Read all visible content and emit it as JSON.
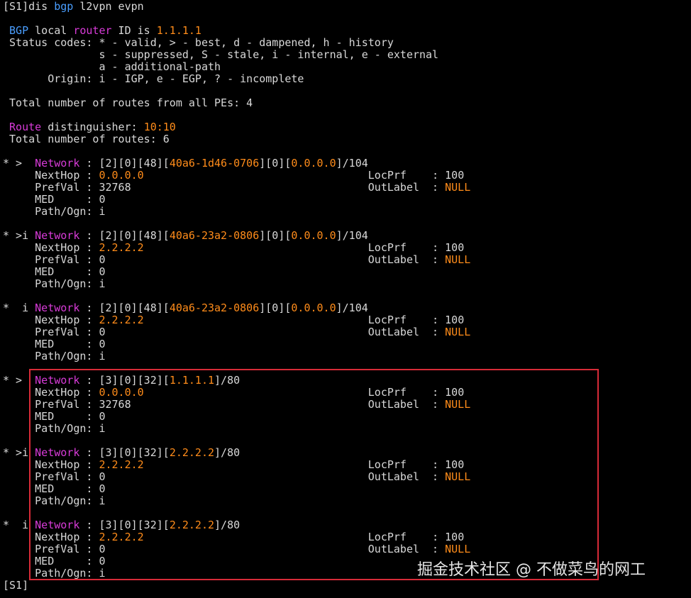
{
  "colors": {
    "background": "#000000",
    "text": "#d8d8d8",
    "keyword": "#4a9eff",
    "field": "#d83bd8",
    "value": "#ff8c1a",
    "highlight": "#d72b38"
  },
  "lines": [
    [
      [
        "t",
        "[S1]dis "
      ],
      [
        "b",
        "bgp"
      ],
      [
        "t",
        " l2vpn evpn"
      ]
    ],
    [
      [
        "t",
        ""
      ]
    ],
    [
      [
        "t",
        " "
      ],
      [
        "b",
        "BGP"
      ],
      [
        "t",
        " local "
      ],
      [
        "m",
        "router"
      ],
      [
        "t",
        " ID is "
      ],
      [
        "o",
        "1.1.1.1"
      ]
    ],
    [
      [
        "t",
        " Status codes: * - valid, > - best, d - dampened, h - history"
      ]
    ],
    [
      [
        "t",
        "               s - suppressed, S - stale, i - internal, e - external"
      ]
    ],
    [
      [
        "t",
        "               a - additional-path"
      ]
    ],
    [
      [
        "t",
        "       Origin: i - IGP, e - EGP, ? - incomplete"
      ]
    ],
    [
      [
        "t",
        ""
      ]
    ],
    [
      [
        "t",
        " Total number of routes from all PEs: 4"
      ]
    ],
    [
      [
        "t",
        ""
      ]
    ],
    [
      [
        "t",
        " "
      ],
      [
        "m",
        "Route"
      ],
      [
        "t",
        " distinguisher: "
      ],
      [
        "o",
        "10:10"
      ]
    ],
    [
      [
        "t",
        " Total number of routes: 6"
      ]
    ],
    [
      [
        "t",
        ""
      ]
    ],
    [
      [
        "t",
        "* >  "
      ],
      [
        "m",
        "Network"
      ],
      [
        "t",
        " : [2][0][48]["
      ],
      [
        "o",
        "40a6-1d46-0706"
      ],
      [
        "t",
        "][0]["
      ],
      [
        "o",
        "0.0.0.0"
      ],
      [
        "t",
        "]/104"
      ]
    ],
    [
      [
        "t",
        "     NextHop : "
      ],
      [
        "o",
        "0.0.0.0"
      ],
      [
        "t",
        "                                   LocPrf    : 100"
      ]
    ],
    [
      [
        "t",
        "     PrefVal : 32768                                     OutLabel  : "
      ],
      [
        "o",
        "NULL"
      ]
    ],
    [
      [
        "t",
        "     MED     : 0"
      ]
    ],
    [
      [
        "t",
        "     Path/Ogn: i"
      ]
    ],
    [
      [
        "t",
        ""
      ]
    ],
    [
      [
        "t",
        "* >i "
      ],
      [
        "m",
        "Network"
      ],
      [
        "t",
        " : [2][0][48]["
      ],
      [
        "o",
        "40a6-23a2-0806"
      ],
      [
        "t",
        "][0]["
      ],
      [
        "o",
        "0.0.0.0"
      ],
      [
        "t",
        "]/104"
      ]
    ],
    [
      [
        "t",
        "     NextHop : "
      ],
      [
        "o",
        "2.2.2.2"
      ],
      [
        "t",
        "                                   LocPrf    : 100"
      ]
    ],
    [
      [
        "t",
        "     PrefVal : 0                                         OutLabel  : "
      ],
      [
        "o",
        "NULL"
      ]
    ],
    [
      [
        "t",
        "     MED     : 0"
      ]
    ],
    [
      [
        "t",
        "     Path/Ogn: i"
      ]
    ],
    [
      [
        "t",
        ""
      ]
    ],
    [
      [
        "t",
        "*  i "
      ],
      [
        "m",
        "Network"
      ],
      [
        "t",
        " : [2][0][48]["
      ],
      [
        "o",
        "40a6-23a2-0806"
      ],
      [
        "t",
        "][0]["
      ],
      [
        "o",
        "0.0.0.0"
      ],
      [
        "t",
        "]/104"
      ]
    ],
    [
      [
        "t",
        "     NextHop : "
      ],
      [
        "o",
        "2.2.2.2"
      ],
      [
        "t",
        "                                   LocPrf    : 100"
      ]
    ],
    [
      [
        "t",
        "     PrefVal : 0                                         OutLabel  : "
      ],
      [
        "o",
        "NULL"
      ]
    ],
    [
      [
        "t",
        "     MED     : 0"
      ]
    ],
    [
      [
        "t",
        "     Path/Ogn: i"
      ]
    ],
    [
      [
        "t",
        ""
      ]
    ],
    [
      [
        "t",
        "* >  "
      ],
      [
        "m",
        "Network"
      ],
      [
        "t",
        " : [3][0][32]["
      ],
      [
        "o",
        "1.1.1.1"
      ],
      [
        "t",
        "]/80"
      ]
    ],
    [
      [
        "t",
        "     NextHop : "
      ],
      [
        "o",
        "0.0.0.0"
      ],
      [
        "t",
        "                                   LocPrf    : 100"
      ]
    ],
    [
      [
        "t",
        "     PrefVal : 32768                                     OutLabel  : "
      ],
      [
        "o",
        "NULL"
      ]
    ],
    [
      [
        "t",
        "     MED     : 0"
      ]
    ],
    [
      [
        "t",
        "     Path/Ogn: i"
      ]
    ],
    [
      [
        "t",
        ""
      ]
    ],
    [
      [
        "t",
        "* >i "
      ],
      [
        "m",
        "Network"
      ],
      [
        "t",
        " : [3][0][32]["
      ],
      [
        "o",
        "2.2.2.2"
      ],
      [
        "t",
        "]/80"
      ]
    ],
    [
      [
        "t",
        "     NextHop : "
      ],
      [
        "o",
        "2.2.2.2"
      ],
      [
        "t",
        "                                   LocPrf    : 100"
      ]
    ],
    [
      [
        "t",
        "     PrefVal : 0                                         OutLabel  : "
      ],
      [
        "o",
        "NULL"
      ]
    ],
    [
      [
        "t",
        "     MED     : 0"
      ]
    ],
    [
      [
        "t",
        "     Path/Ogn: i"
      ]
    ],
    [
      [
        "t",
        ""
      ]
    ],
    [
      [
        "t",
        "*  i "
      ],
      [
        "m",
        "Network"
      ],
      [
        "t",
        " : [3][0][32]["
      ],
      [
        "o",
        "2.2.2.2"
      ],
      [
        "t",
        "]/80"
      ]
    ],
    [
      [
        "t",
        "     NextHop : "
      ],
      [
        "o",
        "2.2.2.2"
      ],
      [
        "t",
        "                                   LocPrf    : 100"
      ]
    ],
    [
      [
        "t",
        "     PrefVal : 0                                         OutLabel  : "
      ],
      [
        "o",
        "NULL"
      ]
    ],
    [
      [
        "t",
        "     MED     : 0"
      ]
    ],
    [
      [
        "t",
        "     Path/Ogn: i"
      ]
    ],
    [
      [
        "t",
        "[S1]"
      ]
    ]
  ],
  "watermark": "掘金技术社区 @ 不做菜鸟的网工"
}
